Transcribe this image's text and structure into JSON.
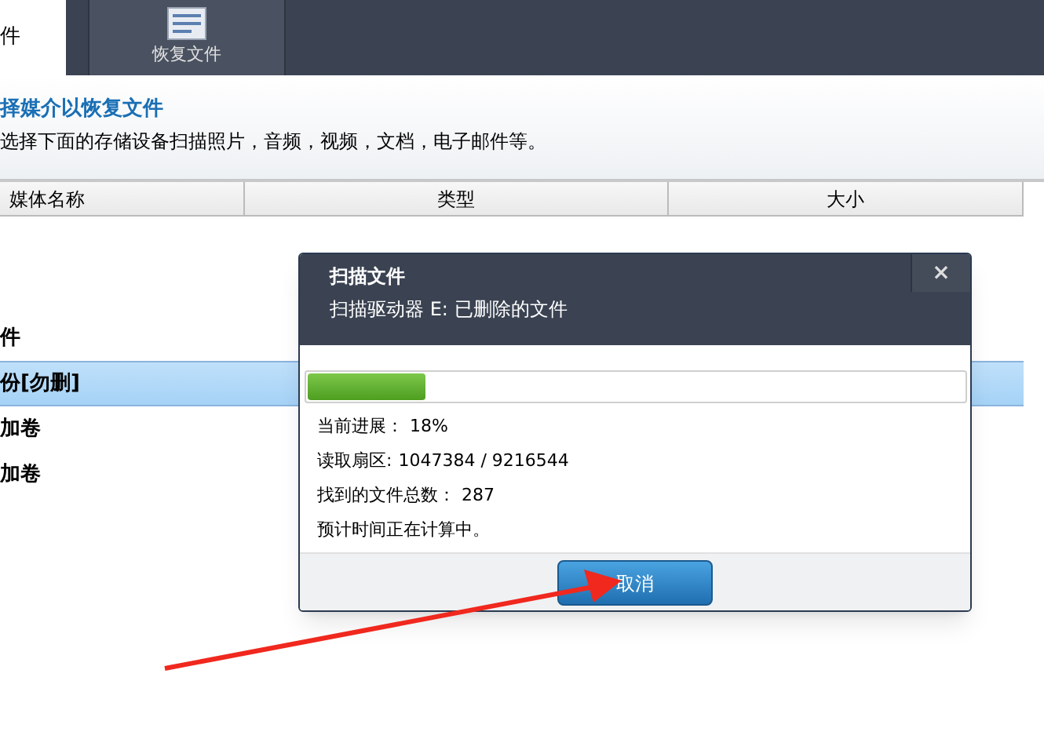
{
  "top_label": "件",
  "toolbar": [
    {
      "label": "恢复文件",
      "selected": true
    }
  ],
  "heading": "择媒介以恢复文件",
  "description": "选择下面的存储设备扫描照片，音频，视频，文档，电子邮件等。",
  "table": {
    "columns": [
      "媒体名称",
      "类型",
      "大小"
    ],
    "rows": [
      {
        "name": "件",
        "selected": false
      },
      {
        "name": "份[勿删]",
        "selected": true
      },
      {
        "name": "加卷",
        "selected": false
      },
      {
        "name": "加卷",
        "selected": false
      }
    ]
  },
  "dialog": {
    "title": "扫描文件",
    "subtitle": "扫描驱动器 E: 已删除的文件",
    "close": "×",
    "progress": {
      "level": 0.18
    },
    "lines": [
      {
        "label": "当前进展：",
        "value": "18%"
      },
      {
        "label": "读取扇区:",
        "value": "1047384 / 9216544"
      },
      {
        "label": "找到的文件总数：",
        "value": "287"
      },
      {
        "label": "预计时间正在计算中。"
      }
    ],
    "button": "取消"
  }
}
